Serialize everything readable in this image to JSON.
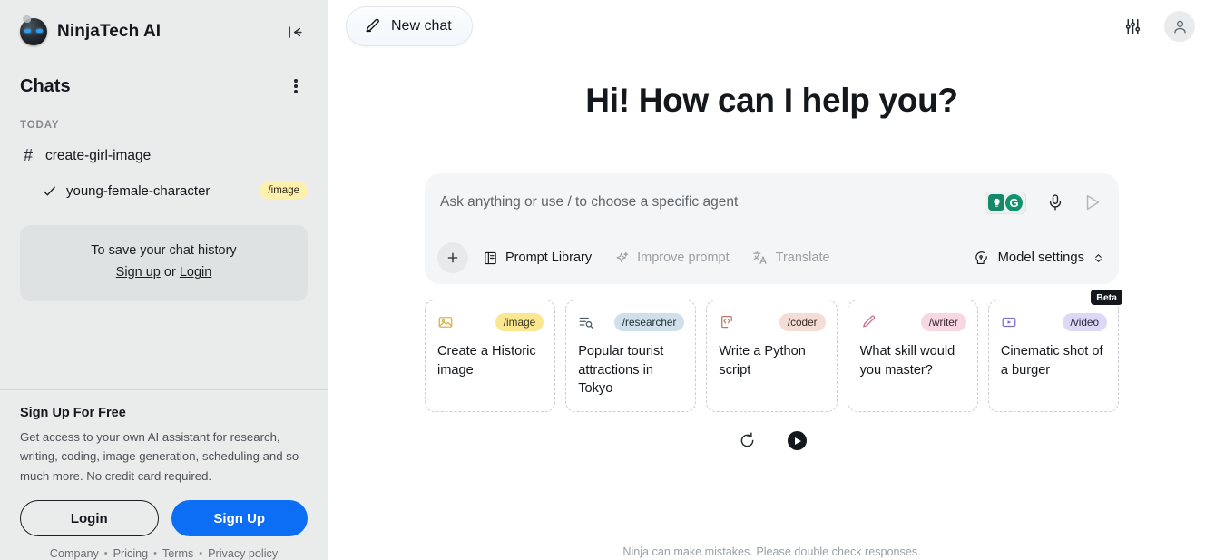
{
  "sidebar": {
    "brand_name": "NinjaTech AI",
    "collapse_icon": "collapse-left-icon",
    "chats_title": "Chats",
    "kebab_icon": "more-vertical-icon",
    "section_label": "TODAY",
    "chats": [
      {
        "icon": "hash-icon",
        "label": "create-girl-image",
        "tag": ""
      },
      {
        "icon": "check-icon",
        "label": "young-female-character",
        "tag": "/image"
      }
    ],
    "save_card": {
      "line1": "To save your chat history",
      "signup_link": "Sign up",
      "or_text": "or",
      "login_link": "Login"
    },
    "signup_panel": {
      "title": "Sign Up For Free",
      "description": "Get access to your own AI assistant for research, writing, coding, image generation, scheduling and so much more. No credit card required.",
      "login_label": "Login",
      "signup_label": "Sign Up"
    },
    "footer_links": [
      "Company",
      "Pricing",
      "Terms",
      "Privacy policy"
    ],
    "footer_separator": "•"
  },
  "topbar": {
    "new_chat_label": "New chat",
    "new_chat_icon": "pencil-icon",
    "settings_icon": "sliders-icon",
    "avatar_icon": "user-icon"
  },
  "main": {
    "greeting": "Hi! How can I help you?",
    "disclaimer": "Ninja can make mistakes. Please double check responses."
  },
  "composer": {
    "placeholder": "Ask anything or use / to choose a specific agent",
    "value": "",
    "grammarly_icon": "grammarly-icon",
    "mic_icon": "microphone-icon",
    "send_icon": "send-icon",
    "plus_icon": "plus-icon",
    "tools": [
      {
        "label": "Prompt Library",
        "icon": "book-icon",
        "muted": false
      },
      {
        "label": "Improve prompt",
        "icon": "sparkles-icon",
        "muted": true
      },
      {
        "label": "Translate",
        "icon": "translate-icon",
        "muted": true
      }
    ],
    "model_settings_label": "Model settings",
    "model_settings_icon": "brain-icon",
    "model_settings_chevron": "chevron-updown-icon"
  },
  "cards": [
    {
      "icon": "image-icon",
      "tag": "/image",
      "tag_bg": "#fbe78f",
      "tag_color": "#3a3520",
      "icon_color": "#d9b64a",
      "title": "Create a Historic image",
      "beta": ""
    },
    {
      "icon": "research-icon",
      "tag": "/researcher",
      "tag_bg": "#cfe0ea",
      "tag_color": "#22313a",
      "icon_color": "#4c5b66",
      "title": "Popular tourist attractions in Tokyo",
      "beta": ""
    },
    {
      "icon": "code-icon",
      "tag": "/coder",
      "tag_bg": "#f3ddd4",
      "tag_color": "#3a2a22",
      "icon_color": "#c0796b",
      "title": "Write a Python script",
      "beta": ""
    },
    {
      "icon": "pen-icon",
      "tag": "/writer",
      "tag_bg": "#f6d7e2",
      "tag_color": "#3a2430",
      "icon_color": "#cc6f93",
      "title": "What skill would you master?",
      "beta": ""
    },
    {
      "icon": "video-icon",
      "tag": "/video",
      "tag_bg": "#dcd8f5",
      "tag_color": "#2b2740",
      "icon_color": "#7b6fd1",
      "title": "Cinematic shot of a burger",
      "beta": "Beta"
    }
  ],
  "bottom_controls": {
    "refresh_icon": "refresh-icon",
    "play_icon": "play-icon"
  },
  "colors": {
    "sidebar_bg": "#eaecec",
    "accent_blue": "#0b6ef5",
    "text_primary": "#14181c",
    "text_muted": "#9aa0a6"
  }
}
